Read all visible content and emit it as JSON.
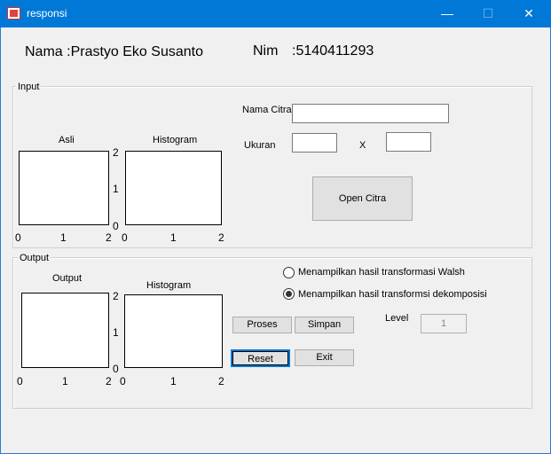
{
  "window": {
    "title": "responsi",
    "minimize": "—",
    "maximize": "☐",
    "close": "✕"
  },
  "header": {
    "nama_label": "Nama  :Prastyo Eko Susanto",
    "nim_label": "Nim",
    "nim_value": ":5140411293"
  },
  "input_panel": {
    "title": "Input",
    "asli_title": "Asli",
    "histogram_title": "Histogram",
    "nama_citra_label": "Nama Citra",
    "nama_citra_value": "",
    "ukuran_label": "Ukuran",
    "ukuran_width": "",
    "x_label": "X",
    "ukuran_height": "",
    "open_button": "Open Citra",
    "asli_xticks": [
      "0",
      "1",
      "2"
    ],
    "hist_yticks": [
      "2",
      "1",
      "0"
    ],
    "hist_xticks": [
      "0",
      "1",
      "2"
    ]
  },
  "output_panel": {
    "title": "Output",
    "output_title": "Output",
    "histogram_title": "Histogram",
    "radio_walsh": "Menampilkan hasil transformasi Walsh",
    "radio_dekomposisi": "Menampilkan hasil transformsi dekomposisi",
    "selected_radio": "dekomposisi",
    "level_label": "Level",
    "level_value": "1",
    "proses_button": "Proses",
    "simpan_button": "Simpan",
    "reset_button": "Reset",
    "exit_button": "Exit",
    "out_xticks": [
      "0",
      "1",
      "2"
    ],
    "hist_yticks": [
      "2",
      "1",
      "0"
    ],
    "hist_xticks": [
      "0",
      "1",
      "2"
    ]
  }
}
